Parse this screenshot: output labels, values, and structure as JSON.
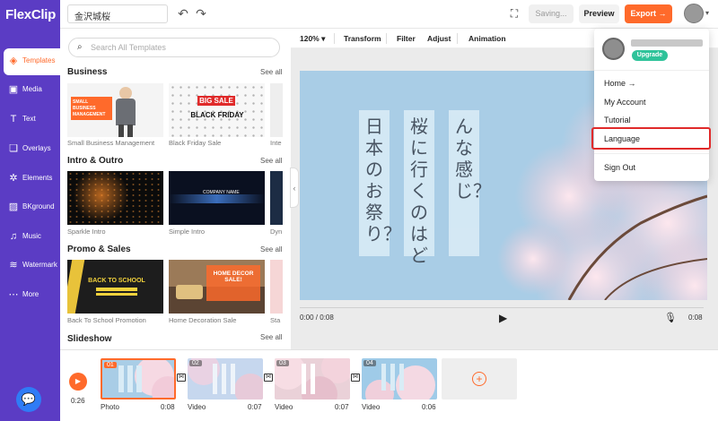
{
  "app": {
    "logo": "FlexClip",
    "project_name": "金沢城桜"
  },
  "header": {
    "saving_label": "Saving...",
    "preview_label": "Preview",
    "export_label": "Export →"
  },
  "nav": {
    "items": [
      {
        "label": "Templates",
        "icon": "template-icon",
        "active": true
      },
      {
        "label": "Media",
        "icon": "media-icon"
      },
      {
        "label": "Text",
        "icon": "text-icon"
      },
      {
        "label": "Overlays",
        "icon": "overlays-icon"
      },
      {
        "label": "Elements",
        "icon": "elements-icon"
      },
      {
        "label": "BKground",
        "icon": "background-icon"
      },
      {
        "label": "Music",
        "icon": "music-icon"
      },
      {
        "label": "Watermark",
        "icon": "watermark-icon"
      },
      {
        "label": "More",
        "icon": "more-icon"
      }
    ]
  },
  "templates": {
    "search_placeholder": "Search All Templates",
    "see_all": "See all",
    "sections": [
      {
        "title": "Business",
        "items": [
          "Small Business Management",
          "Black Friday Sale",
          "Inte"
        ]
      },
      {
        "title": "Intro & Outro",
        "items": [
          "Sparkle Intro",
          "Simple Intro",
          "Dyn"
        ]
      },
      {
        "title": "Promo & Sales",
        "items": [
          "Back To School Promotion",
          "Home Decoration Sale",
          "Sta"
        ]
      },
      {
        "title": "Slideshow",
        "items": []
      }
    ],
    "thumb_text": {
      "small_business": "SMALL BUSINESS\nMANAGEMENT",
      "big_sale": "BIG SALE",
      "black_friday": "BLACK FRIDAY",
      "company_name": "COMPANY NAME",
      "back_to_school": "BACK TO SCHOOL",
      "home_decor": "HOME DECOR SALE!"
    }
  },
  "editor": {
    "zoom": "120%",
    "tools": [
      "Transform",
      "Filter",
      "Adjust",
      "Animation"
    ],
    "canvas_columns": [
      "日本のお祭り？",
      "桜に行くのはど",
      "んな感じ？"
    ],
    "current_time": "0:00 / 0:08",
    "end_time": "0:08"
  },
  "timeline": {
    "total": "0:26",
    "clips": [
      {
        "num": "01",
        "type": "Photo",
        "duration": "0:08",
        "selected": true
      },
      {
        "num": "02",
        "type": "Video",
        "duration": "0:07"
      },
      {
        "num": "03",
        "type": "Video",
        "duration": "0:07"
      },
      {
        "num": "04",
        "type": "Video",
        "duration": "0:06"
      }
    ]
  },
  "user_menu": {
    "upgrade": "Upgrade",
    "items": [
      "Home →",
      "My Account",
      "Tutorial",
      "Language",
      "Sign Out"
    ],
    "highlighted": "Language"
  },
  "colors": {
    "brand": "#5b3cc4",
    "accent": "#ff6a2b",
    "upgrade": "#2fc39a",
    "highlight": "#e02a2a"
  }
}
